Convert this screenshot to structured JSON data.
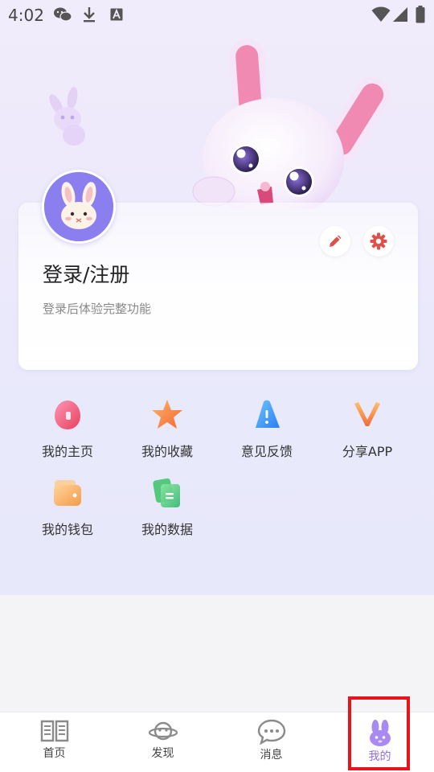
{
  "status_bar": {
    "time": "4:02",
    "icons": [
      "wechat-icon",
      "download-icon",
      "font-icon",
      "wifi-icon",
      "signal-icon",
      "battery-icon"
    ]
  },
  "profile": {
    "title": "登录/注册",
    "subtitle": "登录后体验完整功能",
    "edit_icon": "pencil-icon",
    "settings_icon": "gear-icon"
  },
  "grid": {
    "items": [
      {
        "label": "我的主页",
        "icon": "home-icon"
      },
      {
        "label": "我的收藏",
        "icon": "star-icon"
      },
      {
        "label": "意见反馈",
        "icon": "feedback-icon"
      },
      {
        "label": "分享APP",
        "icon": "share-icon"
      },
      {
        "label": "我的钱包",
        "icon": "wallet-icon"
      },
      {
        "label": "我的数据",
        "icon": "data-icon"
      }
    ]
  },
  "bottom_nav": {
    "items": [
      {
        "label": "首页",
        "icon": "book-icon"
      },
      {
        "label": "发现",
        "icon": "planet-icon"
      },
      {
        "label": "消息",
        "icon": "chat-icon"
      },
      {
        "label": "我的",
        "icon": "bunny-icon"
      }
    ],
    "active_index": 3
  },
  "colors": {
    "accent": "#8e6ee6",
    "highlight": "#e8141c",
    "background_top": "#f1ecfb",
    "background_bottom": "#f4f4f6"
  }
}
